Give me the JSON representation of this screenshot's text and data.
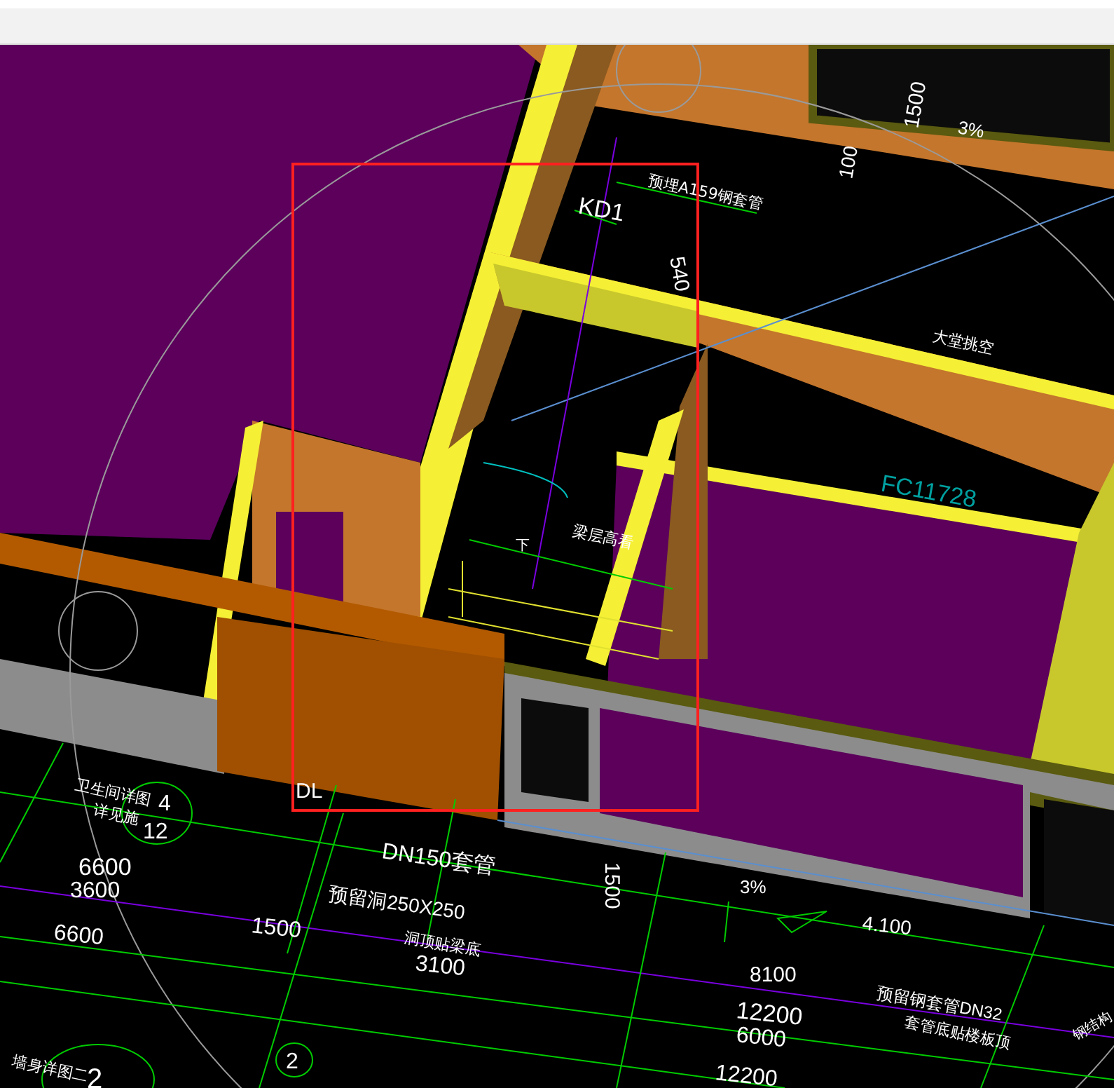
{
  "annotations": [
    {
      "text": "1500",
      "kind": "dimension",
      "color": "#ffffff"
    },
    {
      "text": "3%",
      "kind": "dimension",
      "color": "#ffffff"
    },
    {
      "text": "100",
      "kind": "dimension",
      "color": "#ffffff"
    },
    {
      "text": "KD1",
      "kind": "tag",
      "color": "#ffffff"
    },
    {
      "text": "预埋A159钢套管",
      "kind": "note",
      "color": "#ffffff"
    },
    {
      "text": "540",
      "kind": "dimension",
      "color": "#ffffff"
    },
    {
      "text": "大堂挑空",
      "kind": "note",
      "color": "#ffffff"
    },
    {
      "text": "FC11728",
      "kind": "tag",
      "color": "#00a0a0"
    },
    {
      "text": "梁层高看",
      "kind": "note",
      "color": "#ffffff"
    },
    {
      "text": "下",
      "kind": "note",
      "color": "#ffffff"
    },
    {
      "text": "卫生间详图",
      "kind": "note",
      "color": "#ffffff"
    },
    {
      "text": "详见施",
      "kind": "note",
      "color": "#ffffff"
    },
    {
      "text": "4",
      "kind": "axis",
      "color": "#ffffff"
    },
    {
      "text": "12",
      "kind": "axis",
      "color": "#ffffff"
    },
    {
      "text": "DL",
      "kind": "tag",
      "color": "#ffffff"
    },
    {
      "text": "DN150套管",
      "kind": "tag",
      "color": "#ffffff"
    },
    {
      "text": "6600",
      "kind": "dimension",
      "color": "#ffffff"
    },
    {
      "text": "3600",
      "kind": "dimension",
      "color": "#ffffff"
    },
    {
      "text": "6600",
      "kind": "dimension",
      "color": "#ffffff"
    },
    {
      "text": "1500",
      "kind": "dimension",
      "color": "#ffffff"
    },
    {
      "text": "预留洞250X250",
      "kind": "tag",
      "color": "#ffffff"
    },
    {
      "text": "洞顶贴梁底",
      "kind": "note",
      "color": "#ffffff"
    },
    {
      "text": "3100",
      "kind": "dimension",
      "color": "#ffffff"
    },
    {
      "text": "1500",
      "kind": "dimension",
      "color": "#ffffff"
    },
    {
      "text": "3%",
      "kind": "dimension",
      "color": "#ffffff"
    },
    {
      "text": "4.100",
      "kind": "dimension",
      "color": "#ffffff"
    },
    {
      "text": "8100",
      "kind": "dimension",
      "color": "#ffffff"
    },
    {
      "text": "12200",
      "kind": "dimension",
      "color": "#ffffff"
    },
    {
      "text": "6000",
      "kind": "dimension",
      "color": "#ffffff"
    },
    {
      "text": "预留钢套管DN32",
      "kind": "tag",
      "color": "#ffffff"
    },
    {
      "text": "套管底贴楼板顶",
      "kind": "note",
      "color": "#ffffff"
    },
    {
      "text": "12200",
      "kind": "dimension",
      "color": "#ffffff"
    },
    {
      "text": "墙身详图二",
      "kind": "note",
      "color": "#ffffff"
    },
    {
      "text": "2",
      "kind": "axis",
      "color": "#ffffff"
    },
    {
      "text": "2",
      "kind": "axis",
      "color": "#ffffff"
    },
    {
      "text": "钢结构",
      "kind": "note",
      "color": "#ffffff"
    }
  ]
}
